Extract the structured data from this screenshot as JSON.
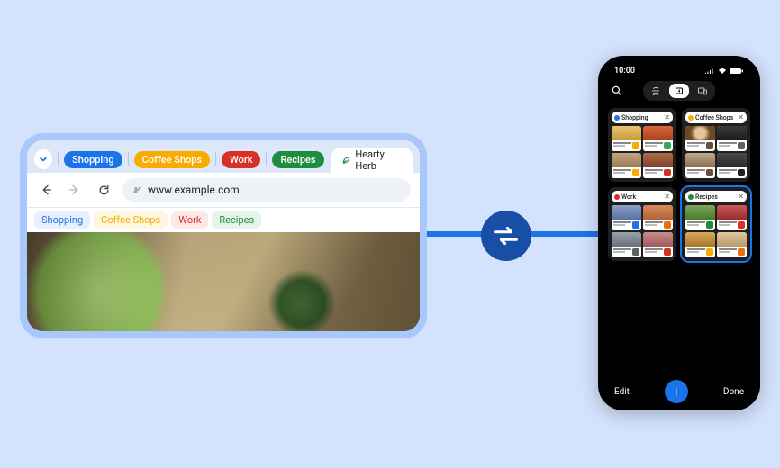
{
  "colors": {
    "blue": "#1a73e8",
    "yellow": "#f9ab00",
    "red": "#d93025",
    "green": "#1e8e3e",
    "bm_blue_bg": "#e8f0fe",
    "bm_yellow_bg": "#fef7e0",
    "bm_red_bg": "#fce8e6",
    "bm_green_bg": "#e6f4ea"
  },
  "desktop": {
    "groups": [
      {
        "label": "Shopping",
        "color_key": "blue"
      },
      {
        "label": "Coffee Shops",
        "color_key": "yellow"
      },
      {
        "label": "Work",
        "color_key": "red"
      },
      {
        "label": "Recipes",
        "color_key": "green"
      }
    ],
    "active_tab": {
      "title": "Hearty Herb"
    },
    "url": "www.example.com",
    "bookmarks": [
      {
        "label": "Shopping",
        "text_key": "blue",
        "bg_key": "bm_blue_bg"
      },
      {
        "label": "Coffee Shops",
        "text_key": "yellow",
        "bg_key": "bm_yellow_bg"
      },
      {
        "label": "Work",
        "text_key": "red",
        "bg_key": "bm_red_bg"
      },
      {
        "label": "Recipes",
        "text_key": "green",
        "bg_key": "bm_green_bg"
      }
    ]
  },
  "phone": {
    "time": "10:00",
    "groups": [
      {
        "label": "Shopping",
        "color_key": "blue",
        "selected": false,
        "tiles": [
          {
            "img": "linear-gradient(#e8c46a,#c79a3a)",
            "badge": "#f9ab00"
          },
          {
            "img": "linear-gradient(#d9643a,#a8431f)",
            "badge": "#34a853"
          },
          {
            "img": "linear-gradient(#c4a484,#9b7b56)",
            "badge": "#f9ab00"
          },
          {
            "img": "linear-gradient(#b06a4a,#7a432a)",
            "badge": "#d93025"
          }
        ]
      },
      {
        "label": "Coffee Shops",
        "color_key": "yellow",
        "selected": false,
        "tiles": [
          {
            "img": "radial-gradient(circle,#e8c49a 30%,#6b4a2a 60%)",
            "badge": "#6d4c41"
          },
          {
            "img": "linear-gradient(#3a3a3a,#1a1a1a)",
            "badge": "#5f6368"
          },
          {
            "img": "linear-gradient(#bfa88a,#8a6f4f)",
            "badge": "#6d4c41"
          },
          {
            "img": "linear-gradient(#4a4a4a,#2a2a2a)",
            "badge": "#202124"
          }
        ]
      },
      {
        "label": "Work",
        "color_key": "red",
        "selected": false,
        "tiles": [
          {
            "img": "linear-gradient(#8aa0c8,#5a72a0)",
            "badge": "#1a73e8"
          },
          {
            "img": "linear-gradient(#d88a5a,#b0623a)",
            "badge": "#e8710a"
          },
          {
            "img": "linear-gradient(#9aa0a8,#6a7078)",
            "badge": "#5f6368"
          },
          {
            "img": "linear-gradient(#c88a8a,#a05a5a)",
            "badge": "#d93025"
          }
        ]
      },
      {
        "label": "Recipes",
        "color_key": "green",
        "selected": true,
        "tiles": [
          {
            "img": "linear-gradient(#7aa85a,#4a7a2a)",
            "badge": "#1e8e3e"
          },
          {
            "img": "linear-gradient(#c85a5a,#982a2a)",
            "badge": "#d93025"
          },
          {
            "img": "linear-gradient(#d8a85a,#a8782a)",
            "badge": "#f9ab00"
          },
          {
            "img": "linear-gradient(#e0c89a,#b89a6a)",
            "badge": "#e8710a"
          }
        ]
      }
    ],
    "edit_label": "Edit",
    "done_label": "Done"
  }
}
